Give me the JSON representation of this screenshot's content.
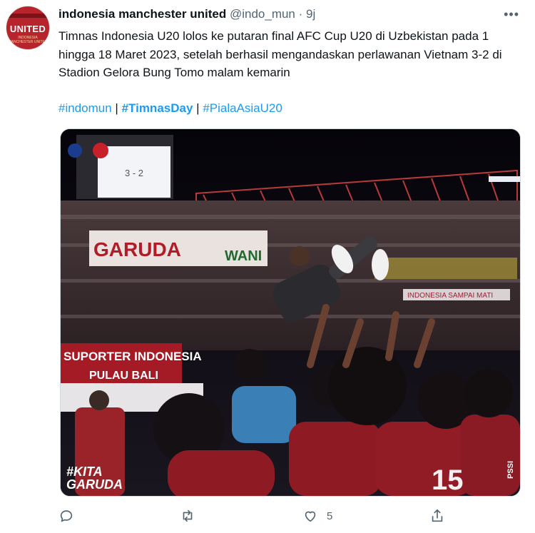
{
  "account": {
    "display_name": "indonesia manchester united",
    "handle": "@indo_mun",
    "separator": "·",
    "time": "9j",
    "avatar_text": "UNITED",
    "avatar_subtext": "INDONESIA MANCHESTER UNITED"
  },
  "tweet": {
    "text": "Timnas Indonesia U20 lolos ke putaran final AFC Cup U20 di Uzbekistan pada 1 hingga 18 Maret 2023, setelah berhasil mengandaskan perlawanan Vietnam 3-2 di Stadion Gelora Bung Tomo malam kemarin",
    "hashtags": [
      "#indomun",
      "#TimnasDay",
      "#PialaAsiaU20"
    ],
    "hashtag_separator": "|"
  },
  "media": {
    "scoreboard": "3 - 2",
    "banner_garuda": "GARUDA",
    "banner_wani": "WANI",
    "banner_suporter": "SUPORTER INDONESIA",
    "banner_pulau": "PULAU BALI",
    "banner_right": "INDONESIA SAMPAI MATI",
    "watermark_line1": "#KITA",
    "watermark_line2": "GARUDA",
    "jersey_number": "15",
    "side_mark": "PSSI"
  },
  "actions": {
    "reply_icon": "reply-icon",
    "retweet_icon": "retweet-icon",
    "like_icon": "heart-icon",
    "like_count": "5",
    "share_icon": "share-icon"
  },
  "colors": {
    "link": "#1d9bf0",
    "secondary_text": "#536471",
    "jersey_red": "#8e1b24"
  }
}
